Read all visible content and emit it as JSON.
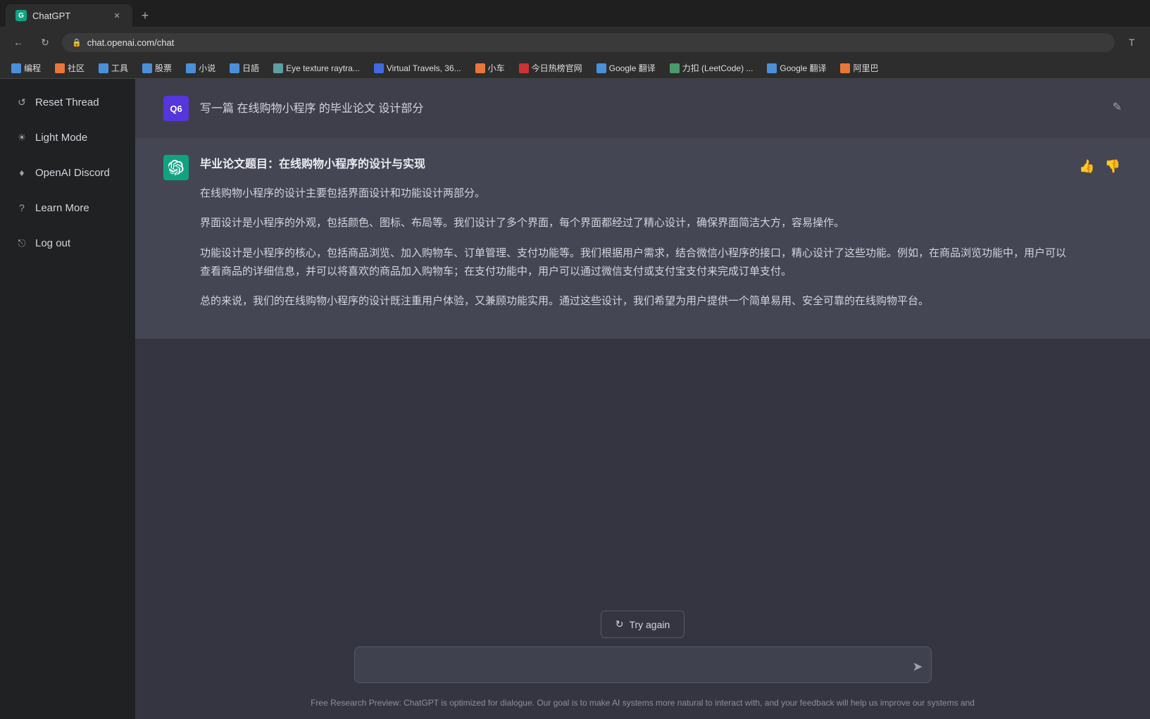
{
  "browser": {
    "tab_title": "ChatGPT",
    "url": "chat.openai.com/chat",
    "new_tab_icon": "+",
    "close_icon": "✕",
    "back_icon": "←",
    "refresh_icon": "↻",
    "translate_icon": "T"
  },
  "bookmarks": [
    {
      "label": "编程",
      "color": "#4a90d9"
    },
    {
      "label": "社区",
      "color": "#e8763a"
    },
    {
      "label": "工具",
      "color": "#4a90d9"
    },
    {
      "label": "股票",
      "color": "#4a90d9"
    },
    {
      "label": "小说",
      "color": "#4a90d9"
    },
    {
      "label": "日語",
      "color": "#4a90d9"
    },
    {
      "label": "Eye texture raytra...",
      "color": "#5f9ea0"
    },
    {
      "label": "Virtual Travels, 36...",
      "color": "#4169e1"
    },
    {
      "label": "小车",
      "color": "#e8763a"
    },
    {
      "label": "今日热榜官网",
      "color": "#cc3333"
    },
    {
      "label": "Google 翻译",
      "color": "#4a90d9"
    },
    {
      "label": "力扣 (LeetCode) ...",
      "color": "#4a9a6e"
    },
    {
      "label": "Google 翻译",
      "color": "#4a90d9"
    },
    {
      "label": "阿里巴",
      "color": "#e8763a"
    }
  ],
  "sidebar": {
    "items": [
      {
        "id": "reset-thread",
        "label": "Reset Thread",
        "icon": "↺"
      },
      {
        "id": "light-mode",
        "label": "Light Mode",
        "icon": "☀"
      },
      {
        "id": "openai-discord",
        "label": "OpenAI Discord",
        "icon": "♦"
      },
      {
        "id": "learn-more",
        "label": "Learn More",
        "icon": "?"
      },
      {
        "id": "log-out",
        "label": "Log out",
        "icon": "⎋"
      }
    ]
  },
  "chat": {
    "question": {
      "label": "Q6",
      "text": "写一篇 在线购物小程序 的毕业论文 设计部分",
      "edit_icon": "✎"
    },
    "answer": {
      "title": "毕业论文题目：在线购物小程序的设计与实现",
      "paragraphs": [
        "在线购物小程序的设计主要包括界面设计和功能设计两部分。",
        "界面设计是小程序的外观，包括颜色、图标、布局等。我们设计了多个界面，每个界面都经过了精心设计，确保界面简洁大方，容易操作。",
        "功能设计是小程序的核心，包括商品浏览、加入购物车、订单管理、支付功能等。我们根据用户需求，结合微信小程序的接口，精心设计了这些功能。例如，在商品浏览功能中，用户可以查看商品的详细信息，并可以将喜欢的商品加入购物车；在支付功能中，用户可以通过微信支付或支付宝支付来完成订单支付。",
        "总的来说，我们的在线购物小程序的设计既注重用户体验，又兼顾功能实用。通过这些设计，我们希望为用户提供一个简单易用、安全可靠的在线购物平台。"
      ],
      "thumbup_icon": "👍",
      "thumbdown_icon": "👎"
    }
  },
  "input": {
    "placeholder": "",
    "try_again_label": "Try again",
    "send_icon": "➤"
  },
  "disclaimer": "Free Research Preview: ChatGPT is optimized for dialogue. Our goal is to make AI systems more natural to interact with, and your feedback will help us improve our systems and"
}
